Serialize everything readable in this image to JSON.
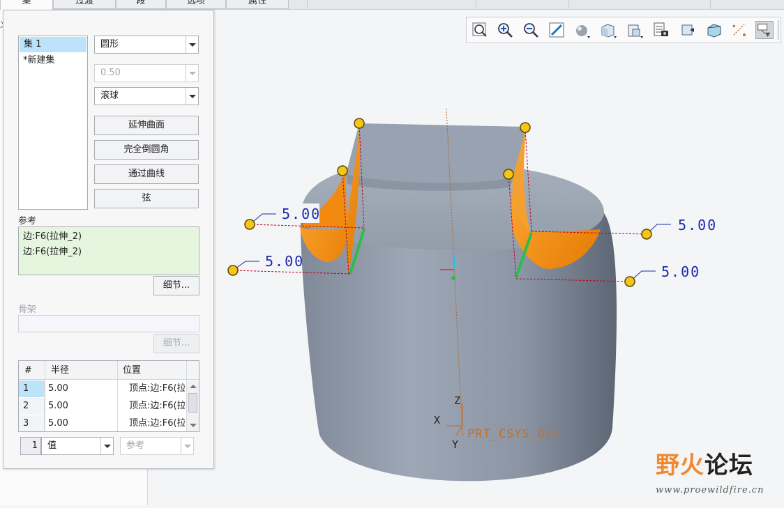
{
  "tabs": [
    {
      "label": "集",
      "active": true
    },
    {
      "label": "过渡",
      "active": false
    },
    {
      "label": "段",
      "active": false
    },
    {
      "label": "选项",
      "active": false
    },
    {
      "label": "属性",
      "active": false
    }
  ],
  "left_strip": {
    "fragment": "义"
  },
  "sets": {
    "items": [
      "集 1",
      "*新建集"
    ],
    "selected_index": 0
  },
  "shape": {
    "cross_section": "圆形",
    "conic_value": "0.50",
    "method": "滚球"
  },
  "buttons": {
    "extend_surfaces": "延伸曲面",
    "full_round": "完全倒圆角",
    "through_curve": "通过曲线",
    "chord": "弦"
  },
  "references": {
    "label": "参考",
    "items": [
      "边:F6(拉伸_2)",
      "边:F6(拉伸_2)"
    ],
    "details_button": "细节..."
  },
  "skeleton": {
    "label": "骨架",
    "details_button": "细节..."
  },
  "radius_table": {
    "columns": [
      "#",
      "半径",
      "位置"
    ],
    "rows": [
      {
        "num": "1",
        "radius": "5.00",
        "location": "顶点:边:F6(拉"
      },
      {
        "num": "2",
        "radius": "5.00",
        "location": "顶点:边:F6(拉"
      },
      {
        "num": "3",
        "radius": "5.00",
        "location": "顶点:边:F6(拉"
      }
    ],
    "selected_row": 0
  },
  "pager": {
    "number": "1",
    "value_type": "值",
    "reference_type": "参考"
  },
  "view_toolbar": {
    "icons": [
      "refit-icon",
      "zoom-in-icon",
      "zoom-out-icon",
      "repaint-icon",
      "display-style-icon",
      "standard-orientation-icon",
      "saved-orientations-icon",
      "view-manager-icon",
      "perspective-view-icon",
      "section-view-icon",
      "datum-display-icon",
      "annotation-display-icon",
      "spin-center-icon"
    ],
    "active_icon": "annotation-display-icon"
  },
  "model": {
    "dimension_labels": [
      "5.00",
      "5.00",
      "5.00",
      "5.00"
    ],
    "csys_label": "PRT_CSYS_DEF",
    "axis_labels": {
      "x": "X",
      "y": "Y",
      "z": "Z"
    },
    "colors": {
      "body": "#8e99a8",
      "fillet": "#f39214",
      "handle": "#f1c40f",
      "edge_highlight": "#2dbd4a",
      "dimension_line": "#c0001a"
    }
  },
  "watermark": {
    "logo_part1": "野火",
    "logo_part2": "论坛",
    "url": "www.proewildfire.cn"
  }
}
